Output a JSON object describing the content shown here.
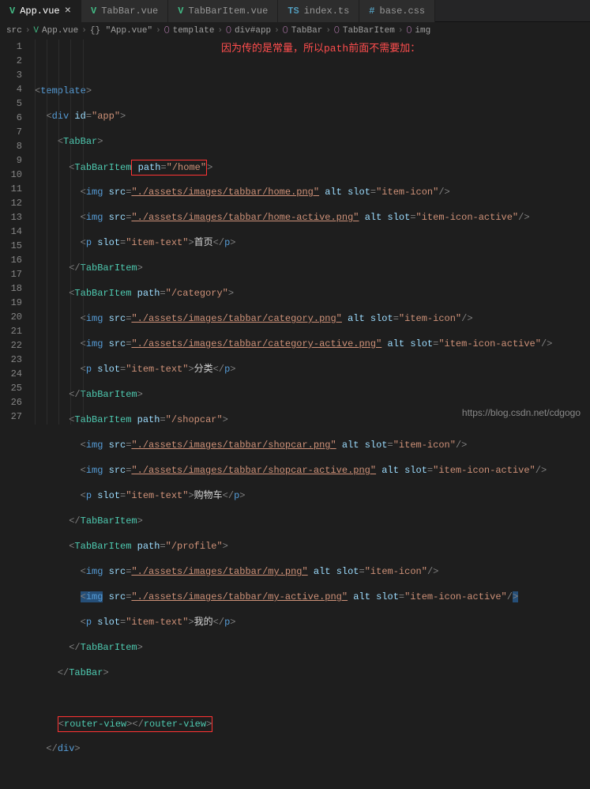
{
  "tabs": [
    {
      "icon": "V",
      "label": "App.vue",
      "active": true
    },
    {
      "icon": "V",
      "label": "TabBar.vue",
      "active": false
    },
    {
      "icon": "V",
      "label": "TabBarItem.vue",
      "active": false
    },
    {
      "icon": "TS",
      "label": "index.ts",
      "active": false
    },
    {
      "icon": "#",
      "label": "base.css",
      "active": false
    }
  ],
  "breadcrumbs": {
    "parts": [
      "src",
      "App.vue",
      "{} \"App.vue\"",
      "template",
      "div#app",
      "TabBar",
      "TabBarItem",
      "img"
    ],
    "sep": "›"
  },
  "annotation": "因为传的是常量，所以path前面不需要加：",
  "watermark": "https://blog.csdn.net/cdgogo",
  "lines": {
    "count": 27,
    "tokens": {
      "template": "template",
      "div": "div",
      "id": "id",
      "app": "\"app\"",
      "tabbar": "TabBar",
      "tabbaritem": "TabBarItem",
      "img": "img",
      "p_tag": "p",
      "src": "src",
      "alt": "alt",
      "slot": "slot",
      "path": "path",
      "routerview": "router-view"
    },
    "paths": {
      "home": "\"/home\"",
      "category": "\"/category\"",
      "shopcar": "\"/shopcar\"",
      "profile": "\"/profile\""
    },
    "images": {
      "home": "\"./assets/images/tabbar/home.png\"",
      "home_active": "\"./assets/images/tabbar/home-active.png\"",
      "category": "\"./assets/images/tabbar/category.png\"",
      "category_active": "\"./assets/images/tabbar/category-active.png\"",
      "shopcar": "\"./assets/images/tabbar/shopcar.png\"",
      "shopcar_active": "\"./assets/images/tabbar/shopcar-active.png\"",
      "my": "\"./assets/images/tabbar/my.png\"",
      "my_active": "\"./assets/images/tabbar/my-active.png\""
    },
    "slots": {
      "icon": "\"item-icon\"",
      "icon_active": "\"item-icon-active\"",
      "text": "\"item-text\""
    },
    "texts": {
      "home": "首页",
      "category": "分类",
      "shopcar": "购物车",
      "profile": "我的"
    }
  }
}
